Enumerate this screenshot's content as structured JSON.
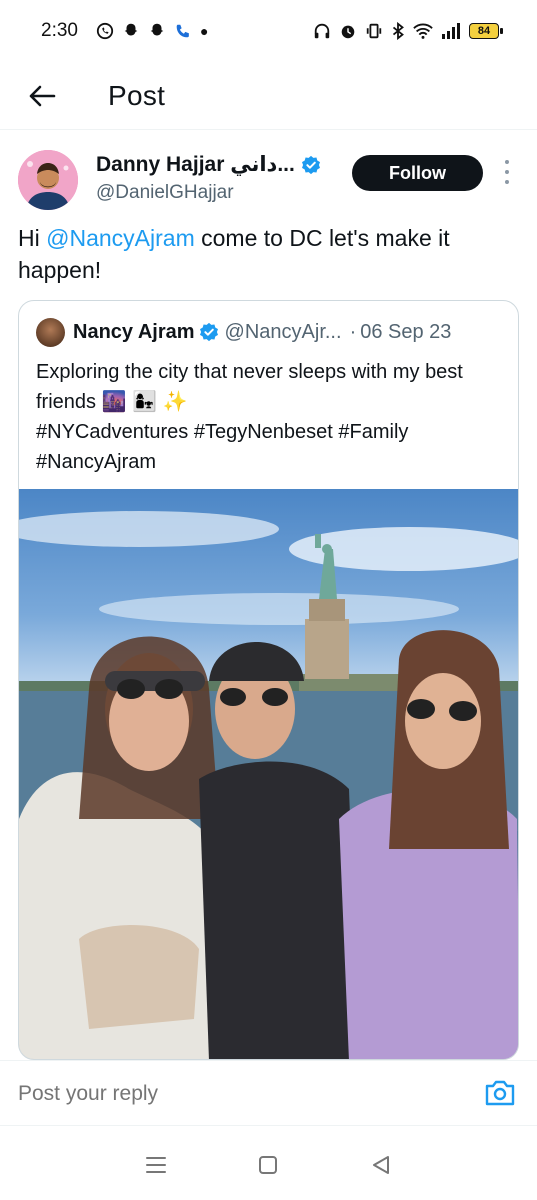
{
  "status_bar": {
    "time": "2:30",
    "battery": "84"
  },
  "header": {
    "title": "Post"
  },
  "post": {
    "author_name": "Danny Hajjar داني...",
    "author_handle": "@DanielGHajjar",
    "follow_label": "Follow",
    "text_prefix": "Hi ",
    "mention": "@NancyAjram",
    "text_suffix": " come to DC let's make it happen!",
    "quote": {
      "author_name": "Nancy Ajram",
      "author_handle": "@NancyAjr...",
      "separator": "·",
      "date": "06 Sep 23",
      "text_line1": "Exploring the city that never sleeps with my best friends 🌆 👩‍👧 ✨",
      "text_line2": "#NYCadventures #TegyNenbeset #Family",
      "text_line3": "#NancyAjram"
    }
  },
  "reply": {
    "placeholder": "Post your reply"
  },
  "colors": {
    "accent": "#1d9bf0",
    "follow_bg": "#0f1419",
    "secondary_text": "#536471"
  }
}
